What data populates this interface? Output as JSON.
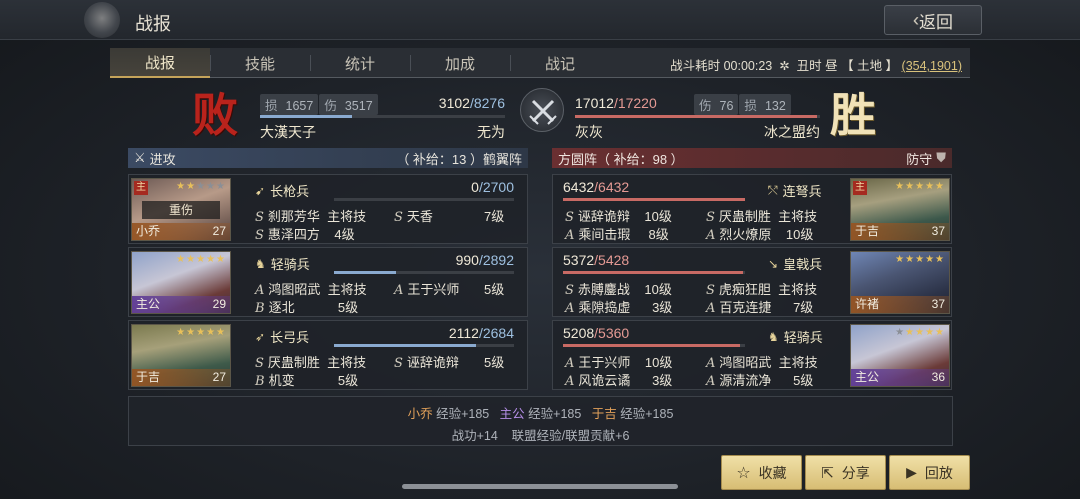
{
  "header": {
    "title": "战报",
    "back_label": "返回"
  },
  "tabs": [
    {
      "label": "战报",
      "active": true
    },
    {
      "label": "技能"
    },
    {
      "label": "统计"
    },
    {
      "label": "加成"
    },
    {
      "label": "战记"
    }
  ],
  "battle_info": {
    "duration_label": "战斗耗时",
    "duration": "00:00:23",
    "time_of_day": "丑时 昼",
    "land": "【 土地 】",
    "coord": "(354,1901)"
  },
  "result": {
    "lose_char": "败",
    "win_char": "胜",
    "attacker": {
      "loss_label": "损",
      "loss": "1657",
      "wound_label": "伤",
      "wound": "3517",
      "hp_current": "3102",
      "hp_max": "/8276",
      "hp_fraction": 0.375,
      "player": "大漢天子",
      "alliance": "无为"
    },
    "defender": {
      "loss_label": "损",
      "loss": "132",
      "wound_label": "伤",
      "wound": "76",
      "hp_current": "17012",
      "hp_max": "/17220",
      "hp_fraction": 0.988,
      "player": "灰灰",
      "alliance": "冰之盟约"
    }
  },
  "attack_header": {
    "label": "进攻",
    "supply": "（ 补给：13 ）鹤翼阵"
  },
  "defense_header": {
    "label": "方圆阵（ 补给：98 ）",
    "role": "防守"
  },
  "attack_units": [
    {
      "name": "小乔",
      "level": "27",
      "lord": "主",
      "status": "重伤",
      "troop": "长枪兵",
      "hp_current": "0",
      "hp_max": "/2700",
      "hp_fraction": 0.0,
      "skills": [
        {
          "type": "S",
          "name": "刹那芳华",
          "level": "主将技"
        },
        {
          "type": "S",
          "name": "天香",
          "level": "7级"
        },
        {
          "type": "S",
          "name": "惠泽四方",
          "level": "4级"
        }
      ]
    },
    {
      "name": "主公",
      "level": "29",
      "troop": "轻骑兵",
      "hp_current": "990",
      "hp_max": "/2892",
      "hp_fraction": 0.342,
      "skills": [
        {
          "type": "A",
          "name": "鸿图昭武",
          "level": "主将技"
        },
        {
          "type": "A",
          "name": "王于兴师",
          "level": "5级"
        },
        {
          "type": "B",
          "name": "逐北",
          "level": "5级"
        }
      ]
    },
    {
      "name": "于吉",
      "level": "27",
      "troop": "长弓兵",
      "hp_current": "2112",
      "hp_max": "/2684",
      "hp_fraction": 0.787,
      "skills": [
        {
          "type": "S",
          "name": "厌蛊制胜",
          "level": "主将技"
        },
        {
          "type": "S",
          "name": "诬辞诡辩",
          "level": "5级"
        },
        {
          "type": "B",
          "name": "机变",
          "level": "5级"
        }
      ]
    }
  ],
  "defense_units": [
    {
      "name": "于吉",
      "level": "37",
      "lord": "主",
      "troop": "连弩兵",
      "hp_current": "6432",
      "hp_max": "/6432",
      "hp_fraction": 1.0,
      "skills": [
        {
          "type": "S",
          "name": "诬辞诡辩",
          "level": "10级"
        },
        {
          "type": "S",
          "name": "厌蛊制胜",
          "level": "主将技"
        },
        {
          "type": "A",
          "name": "乘间击瑕",
          "level": "8级"
        },
        {
          "type": "A",
          "name": "烈火燎原",
          "level": "10级"
        }
      ]
    },
    {
      "name": "许褚",
      "level": "37",
      "troop": "皇戟兵",
      "hp_current": "5372",
      "hp_max": "/5428",
      "hp_fraction": 0.99,
      "skills": [
        {
          "type": "S",
          "name": "赤膊鏖战",
          "level": "10级"
        },
        {
          "type": "S",
          "name": "虎痴狂胆",
          "level": "主将技"
        },
        {
          "type": "A",
          "name": "乘隙捣虚",
          "level": "3级"
        },
        {
          "type": "A",
          "name": "百克连捷",
          "level": "7级"
        }
      ]
    },
    {
      "name": "主公",
      "level": "36",
      "troop": "轻骑兵",
      "hp_current": "5208",
      "hp_max": "/5360",
      "hp_fraction": 0.972,
      "skills": [
        {
          "type": "A",
          "name": "王于兴师",
          "level": "10级"
        },
        {
          "type": "A",
          "name": "鸿图昭武",
          "level": "主将技"
        },
        {
          "type": "A",
          "name": "风诡云谲",
          "level": "3级"
        },
        {
          "type": "A",
          "name": "源清流净",
          "level": "5级"
        }
      ]
    }
  ],
  "rewards": {
    "line1": [
      {
        "name": "小乔",
        "text": "经验+185"
      },
      {
        "name": "主公",
        "text": "经验+185"
      },
      {
        "name": "于吉",
        "text": "经验+185"
      }
    ],
    "line2": "战功+14    联盟经验/联盟贡献+6"
  },
  "actions": {
    "favorite": "收藏",
    "share": "分享",
    "replay": "回放"
  },
  "colors": {
    "accent_gold": "#d7bd74",
    "lose_red": "#b9231c",
    "attack_blue": "#3b4a63",
    "defense_red": "#6a2f31"
  }
}
